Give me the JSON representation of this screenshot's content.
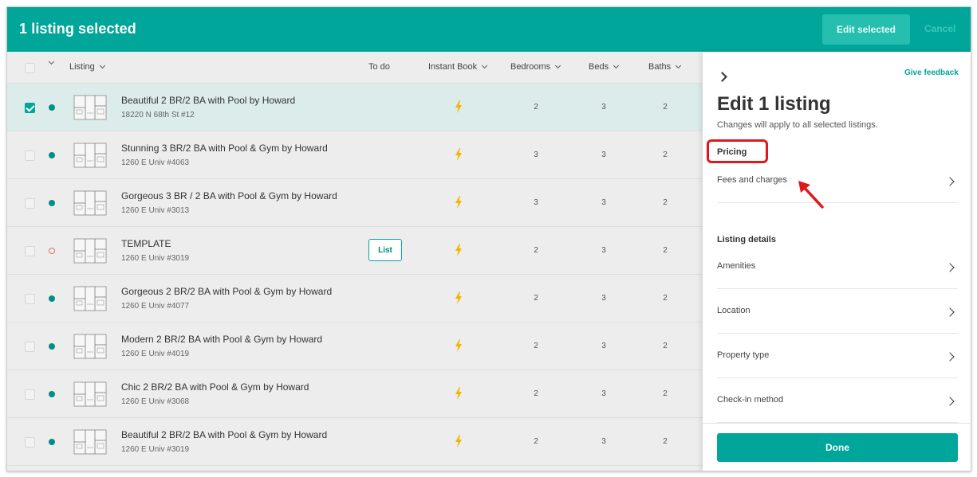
{
  "header": {
    "title": "1 listing selected",
    "edit_selected": "Edit selected",
    "cancel": "Cancel"
  },
  "table": {
    "columns": {
      "listing": "Listing",
      "todo": "To do",
      "instant_book": "Instant Book",
      "bedrooms": "Bedrooms",
      "beds": "Beds",
      "baths": "Baths"
    },
    "rows": [
      {
        "selected": true,
        "status": "active",
        "title": "Beautiful 2 BR/2 BA with Pool by Howard",
        "address": "18220 N 68th St #12",
        "todo": "",
        "bedrooms": "2",
        "beds": "3",
        "baths": "2"
      },
      {
        "selected": false,
        "status": "active",
        "title": "Stunning 3 BR/2 BA with Pool & Gym by Howard",
        "address": "1260 E Univ #4063",
        "todo": "",
        "bedrooms": "3",
        "beds": "3",
        "baths": "2"
      },
      {
        "selected": false,
        "status": "active",
        "title": "Gorgeous 3 BR / 2 BA with Pool & Gym by Howard",
        "address": "1260 E Univ #3013",
        "todo": "",
        "bedrooms": "3",
        "beds": "3",
        "baths": "2"
      },
      {
        "selected": false,
        "status": "unlisted",
        "title": "TEMPLATE",
        "address": "1260 E Univ #3019",
        "todo": "List",
        "bedrooms": "2",
        "beds": "3",
        "baths": "2"
      },
      {
        "selected": false,
        "status": "active",
        "title": "Gorgeous 2 BR/2 BA with Pool & Gym by Howard",
        "address": "1260 E Univ #4077",
        "todo": "",
        "bedrooms": "2",
        "beds": "3",
        "baths": "2"
      },
      {
        "selected": false,
        "status": "active",
        "title": "Modern 2 BR/2 BA with Pool & Gym by Howard",
        "address": "1260 E Univ #4019",
        "todo": "",
        "bedrooms": "2",
        "beds": "3",
        "baths": "2"
      },
      {
        "selected": false,
        "status": "active",
        "title": "Chic 2 BR/2 BA with Pool & Gym by Howard",
        "address": "1260 E Univ #3068",
        "todo": "",
        "bedrooms": "2",
        "beds": "3",
        "baths": "2"
      },
      {
        "selected": false,
        "status": "active",
        "title": "Beautiful 2 BR/2 BA with Pool & Gym by Howard",
        "address": "1260 E Univ #3019",
        "todo": "",
        "bedrooms": "2",
        "beds": "3",
        "baths": "2"
      }
    ]
  },
  "panel": {
    "feedback": "Give feedback",
    "title": "Edit 1 listing",
    "subtitle": "Changes will apply to all selected listings.",
    "pricing_heading": "Pricing",
    "pricing_items": [
      "Fees and charges"
    ],
    "details_heading": "Listing details",
    "details_items": [
      "Amenities",
      "Location",
      "Property type",
      "Check-in method"
    ],
    "done": "Done"
  },
  "colors": {
    "brand": "#00a699",
    "highlight": "#e0181b",
    "instant_book": "#f5b400"
  },
  "icons": {
    "instant_book": "lightning-bolt-icon",
    "row_thumbnail": "floor-plan-thumbnail",
    "status_dot": "status-dot-icon"
  }
}
